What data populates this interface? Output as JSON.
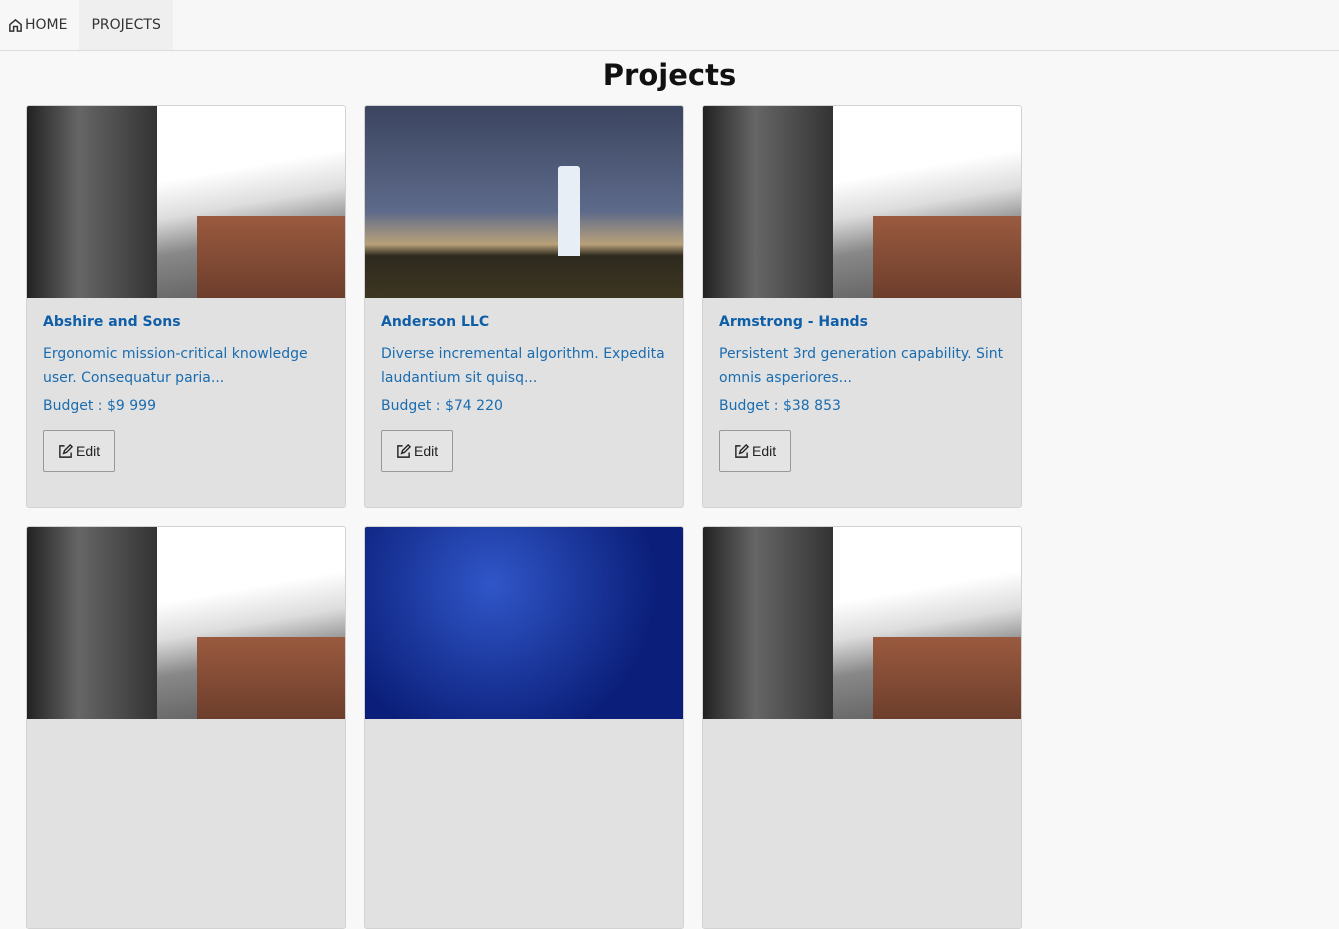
{
  "nav": {
    "home": "HOME",
    "projects": "PROJECTS"
  },
  "page_title": "Projects",
  "budget_label": "Budget : ",
  "edit_label": "Edit",
  "projects": [
    {
      "title": "Abshire and Sons",
      "description": "Ergonomic mission-critical knowledge user. Consequatur paria...",
      "budget": "$9 999"
    },
    {
      "title": "Anderson LLC",
      "description": "Diverse incremental algorithm. Expedita laudantium sit quisq...",
      "budget": "$74 220"
    },
    {
      "title": "Armstrong - Hands",
      "description": "Persistent 3rd generation capability. Sint omnis asperiores...",
      "budget": "$38 853"
    }
  ]
}
